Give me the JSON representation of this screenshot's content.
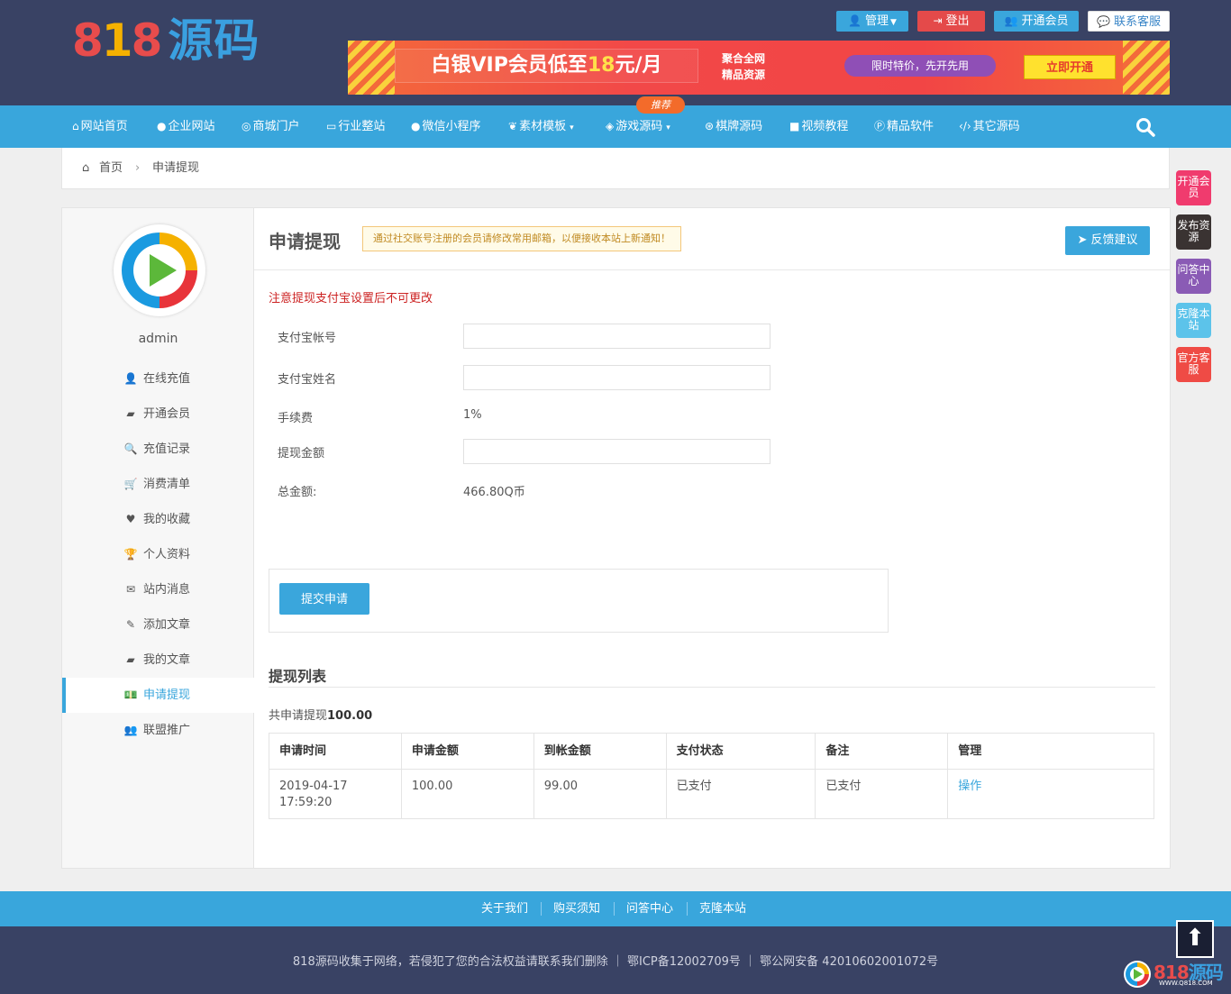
{
  "header": {
    "logo_digits": [
      "8",
      "1",
      "8"
    ],
    "logo_text": "源码",
    "top_buttons": [
      {
        "label": "管理",
        "icon": "user-icon",
        "color": "#3aa6dc"
      },
      {
        "label": "登出",
        "icon": "logout-icon",
        "color": "#e44a4a"
      },
      {
        "label": "开通会员",
        "icon": "users-icon",
        "color": "#3aa6dc"
      },
      {
        "label": "联系客服",
        "icon": "chat-icon",
        "color": "#ffffff"
      }
    ],
    "banner": {
      "main_pre": "白银VIP会员低至",
      "main_num": "18",
      "main_post": "元/月",
      "sub_line1": "聚合全网",
      "sub_line2": "精品资源",
      "pill": "限时特价，先开先用",
      "cta": "立即开通"
    }
  },
  "nav": {
    "badge": "推荐",
    "items": [
      {
        "label": "网站首页",
        "icon": "home-icon"
      },
      {
        "label": "企业网站",
        "icon": "building-icon"
      },
      {
        "label": "商城门户",
        "icon": "github-icon"
      },
      {
        "label": "行业整站",
        "icon": "card-icon"
      },
      {
        "label": "微信小程序",
        "icon": "wechat-icon"
      },
      {
        "label": "素材模板",
        "icon": "leaf-icon",
        "dropdown": true
      },
      {
        "label": "游戏源码",
        "icon": "diamond-icon",
        "dropdown": true
      },
      {
        "label": "棋牌源码",
        "icon": "chess-icon"
      },
      {
        "label": "视频教程",
        "icon": "video-icon"
      },
      {
        "label": "精品软件",
        "icon": "p-icon"
      },
      {
        "label": "其它源码",
        "icon": "code-icon"
      }
    ]
  },
  "breadcrumb": {
    "home": "首页",
    "sep": "›",
    "current": "申请提现"
  },
  "floats": [
    {
      "label": "开通会员",
      "color": "#f03b6e"
    },
    {
      "label": "发布资源",
      "color": "#3a3332"
    },
    {
      "label": "问答中心",
      "color": "#8a5bb5"
    },
    {
      "label": "克隆本站",
      "color": "#5cc3ea"
    },
    {
      "label": "官方客服",
      "color": "#ef4b45"
    }
  ],
  "sidebar": {
    "username": "admin",
    "items": [
      {
        "label": "在线充值",
        "icon": "user-icon"
      },
      {
        "label": "开通会员",
        "icon": "book-icon"
      },
      {
        "label": "充值记录",
        "icon": "search-icon"
      },
      {
        "label": "消费清单",
        "icon": "cart-icon"
      },
      {
        "label": "我的收藏",
        "icon": "heart-icon"
      },
      {
        "label": "个人资料",
        "icon": "trophy-icon"
      },
      {
        "label": "站内消息",
        "icon": "envelope-icon"
      },
      {
        "label": "添加文章",
        "icon": "edit-icon"
      },
      {
        "label": "我的文章",
        "icon": "book-icon"
      },
      {
        "label": "申请提现",
        "icon": "money-icon",
        "active": true
      },
      {
        "label": "联盟推广",
        "icon": "users-icon"
      }
    ]
  },
  "content": {
    "title": "申请提现",
    "tip": "通过社交账号注册的会员请修改常用邮箱，以便接收本站上新通知！",
    "feedback": "反馈建议",
    "warning": "注意提现支付宝设置后不可更改",
    "form": {
      "alipay_account_label": "支付宝帐号",
      "alipay_account_value": "",
      "alipay_name_label": "支付宝姓名",
      "alipay_name_value": "",
      "fee_label": "手续费",
      "fee_value": "1%",
      "amount_label": "提现金额",
      "amount_value": "",
      "total_label": "总金额:",
      "total_value": "466.80Q币"
    },
    "submit": "提交申请",
    "list_title": "提现列表",
    "summary_pre": "共申请提现",
    "summary_amount": "100.00",
    "table": {
      "headers": [
        "申请时间",
        "申请金额",
        "到帐金额",
        "支付状态",
        "备注",
        "管理"
      ],
      "rows": [
        {
          "time_date": "2019-04-17",
          "time_clock": "17:59:20",
          "amount": "100.00",
          "received": "99.00",
          "status": "已支付",
          "note": "已支付",
          "action": "操作"
        }
      ]
    }
  },
  "footer": {
    "links": [
      "关于我们",
      "购买须知",
      "问答中心",
      "克隆本站"
    ],
    "copyright": "818源码收集于网络，若侵犯了您的合法权益请联系我们删除 ｜ 鄂ICP备12002709号 ｜ 鄂公网安备 42010602001072号",
    "back_top": "⬆",
    "watermark_digits": "818",
    "watermark_text": "源码",
    "watermark_url": "WWW.Q818.COM"
  }
}
